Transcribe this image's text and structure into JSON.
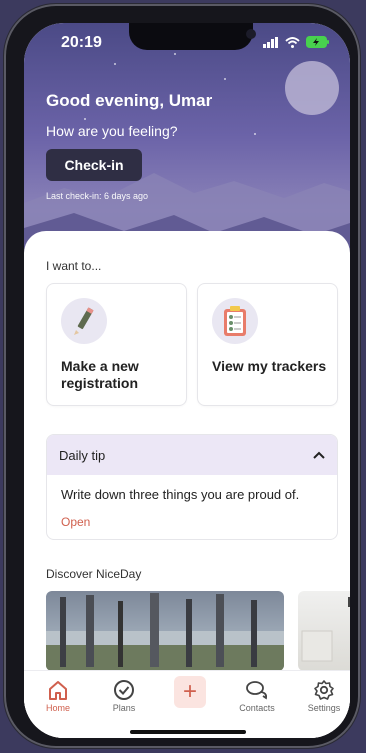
{
  "status": {
    "time": "20:19"
  },
  "hero": {
    "greeting": "Good evening, Umar",
    "question": "How are you feeling?",
    "checkin_label": "Check-in",
    "last_checkin": "Last check-in: 6 days ago"
  },
  "actions": {
    "title": "I want to...",
    "items": [
      {
        "label": "Make a new registration",
        "icon": "pencil-icon"
      },
      {
        "label": "View my trackers",
        "icon": "clipboard-checklist-icon"
      }
    ]
  },
  "tip": {
    "title": "Daily tip",
    "text": "Write down three things you are proud of.",
    "open_label": "Open"
  },
  "discover": {
    "title": "Discover NiceDay"
  },
  "nav": {
    "items": [
      {
        "label": "Home",
        "icon": "home-icon",
        "active": true
      },
      {
        "label": "Plans",
        "icon": "check-circle-icon",
        "active": false
      },
      {
        "label": "",
        "icon": "plus-icon",
        "active": false
      },
      {
        "label": "Contacts",
        "icon": "chat-bubbles-icon",
        "active": false
      },
      {
        "label": "Settings",
        "icon": "gear-icon",
        "active": false
      }
    ]
  },
  "colors": {
    "accent": "#d0604e",
    "hero_top": "#4b4a86",
    "tip_header": "#ece7f6"
  }
}
